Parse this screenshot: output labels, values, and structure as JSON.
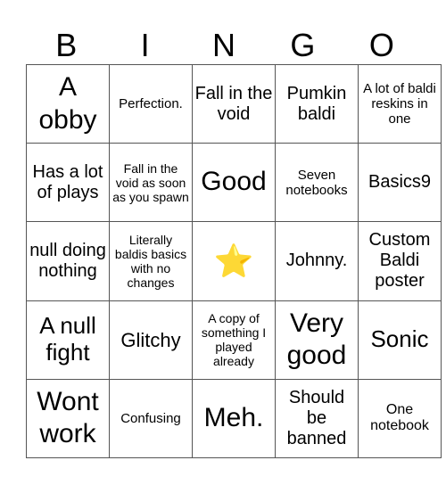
{
  "header": {
    "letters": [
      "B",
      "I",
      "N",
      "G",
      "O"
    ]
  },
  "board": {
    "rows": [
      [
        "A obby",
        "Perfection.",
        "Fall in the void",
        "Pumkin baldi",
        "A lot of baldi reskins in one"
      ],
      [
        "Has a lot of plays",
        "Fall in the void as soon as you spawn",
        "Good",
        "Seven notebooks",
        "Basics9"
      ],
      [
        "null doing nothing",
        "Literally baldis basics with no changes",
        "⭐",
        "Johnny.",
        "Custom Baldi poster"
      ],
      [
        "A null fight",
        "Glitchy",
        "A copy of something I played already",
        "Very good",
        "Sonic"
      ],
      [
        "Wont work",
        "Confusing",
        "Meh.",
        "Should be banned",
        "One notebook"
      ]
    ],
    "free_space_icon": "star-icon"
  }
}
